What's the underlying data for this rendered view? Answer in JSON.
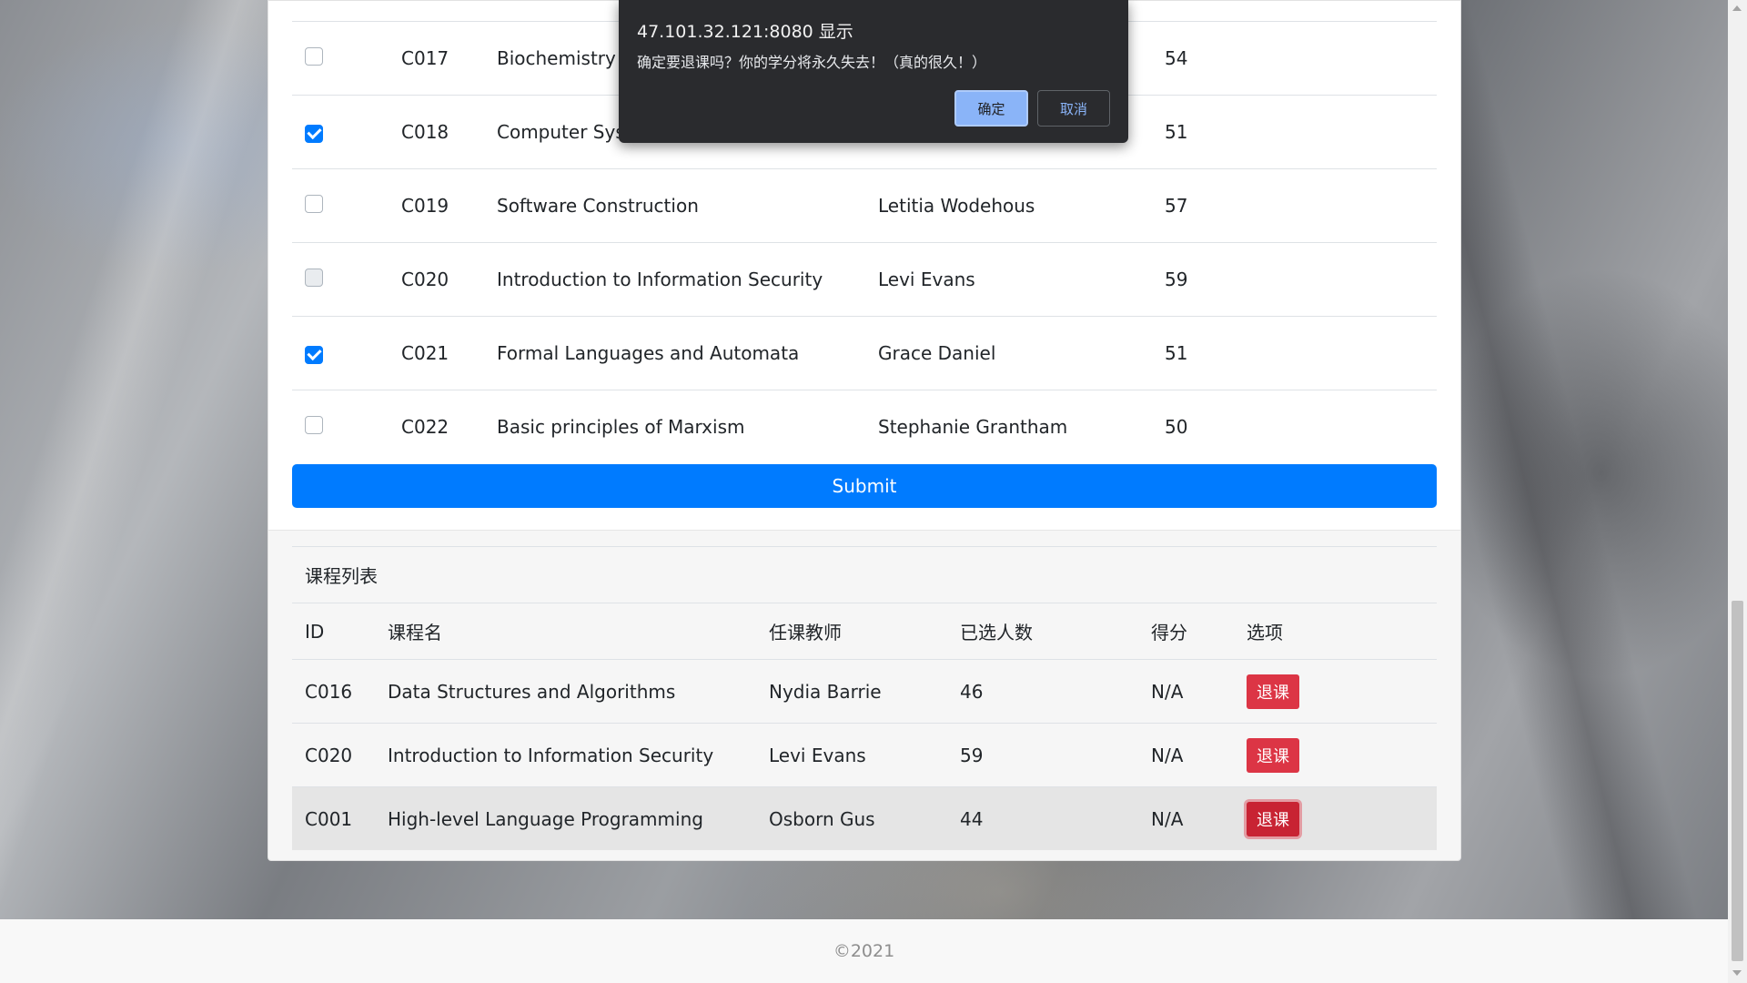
{
  "selection_table": {
    "rows": [
      {
        "checked": false,
        "id": "C017",
        "name": "Biochemistry B",
        "teacher": "",
        "count": "54"
      },
      {
        "checked": true,
        "id": "C018",
        "name": "Computer Syste",
        "teacher": "",
        "count": "51"
      },
      {
        "checked": false,
        "id": "C019",
        "name": "Software Construction",
        "teacher": "Letitia Wodehous",
        "count": "57"
      },
      {
        "checked": false,
        "id": "C020",
        "name": "Introduction to Information Security",
        "teacher": "Levi Evans",
        "count": "59"
      },
      {
        "checked": true,
        "id": "C021",
        "name": "Formal Languages and Automata",
        "teacher": "Grace Daniel",
        "count": "51"
      },
      {
        "checked": false,
        "id": "C022",
        "name": "Basic principles of Marxism",
        "teacher": "Stephanie Grantham",
        "count": "50"
      }
    ],
    "submit_label": "Submit"
  },
  "course_list": {
    "title": "课程列表",
    "headers": {
      "id": "ID",
      "name": "课程名",
      "teacher": "任课教师",
      "count": "已选人数",
      "score": "得分",
      "option": "选项"
    },
    "rows": [
      {
        "id": "C016",
        "name": "Data Structures and Algorithms",
        "teacher": "Nydia Barrie",
        "count": "46",
        "score": "N/A",
        "action": "退课"
      },
      {
        "id": "C020",
        "name": "Introduction to Information Security",
        "teacher": "Levi Evans",
        "count": "59",
        "score": "N/A",
        "action": "退课"
      },
      {
        "id": "C001",
        "name": "High-level Language Programming",
        "teacher": "Osborn Gus",
        "count": "44",
        "score": "N/A",
        "action": "退课"
      }
    ]
  },
  "footer": {
    "text": "©2021"
  },
  "dialog": {
    "title": "47.101.32.121:8080 显示",
    "message": "确定要退课吗？你的学分将永久失去！（真的很久！）",
    "ok_label": "确定",
    "cancel_label": "取消"
  },
  "colors": {
    "primary": "#007bff",
    "danger": "#dc3545",
    "dialog_bg": "#2a2b2e",
    "dialog_ok": "#8ab4f8"
  }
}
